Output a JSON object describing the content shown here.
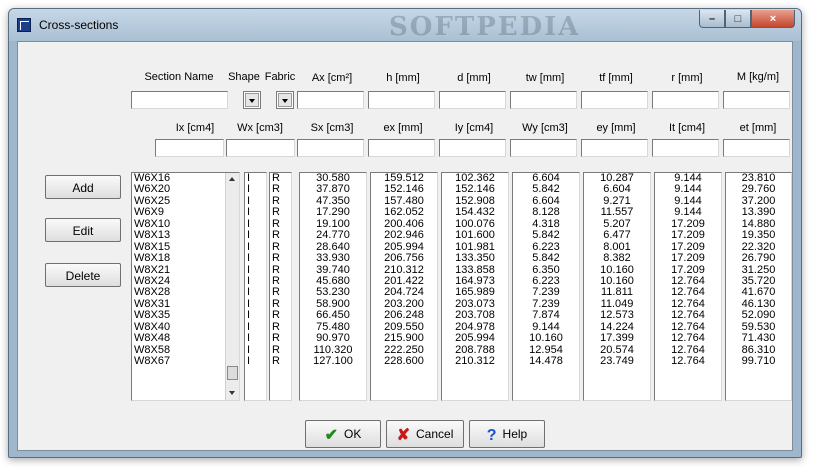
{
  "window": {
    "title": "Cross-sections",
    "watermark": "SOFTPEDIA",
    "controls": {
      "minimize": "–",
      "maximize": "□",
      "close": "×"
    }
  },
  "headers1": [
    "Section Name",
    "Shape",
    "Fabric",
    "Ax  [cm²]",
    "h  [mm]",
    "d  [mm]",
    "tw  [mm]",
    "tf  [mm]",
    "r  [mm]",
    "M  [kg/m]"
  ],
  "headers2": [
    "Ix  [cm4]",
    "Wx  [cm3]",
    "Sx  [cm3]",
    "ex  [mm]",
    "Iy  [cm4]",
    "Wy  [cm3]",
    "ey [mm]",
    "It  [cm4]",
    "et  [mm]"
  ],
  "filters": {
    "section_name": "",
    "shape": "",
    "fabric": "",
    "ax": "",
    "h": "",
    "d": "",
    "tw": "",
    "tf": "",
    "r": "",
    "m": ""
  },
  "filters2": {
    "ix": "",
    "wx": "",
    "sx": "",
    "ex": "",
    "iy": "",
    "wy": "",
    "ey": "",
    "it": "",
    "et": ""
  },
  "buttons": {
    "add": "Add",
    "edit": "Edit",
    "delete": "Delete",
    "ok": "OK",
    "cancel": "Cancel",
    "help": "Help"
  },
  "icons": {
    "ok": "checkmark-icon",
    "cancel": "x-icon",
    "help": "question-icon",
    "app": "app-icon"
  },
  "colors": {
    "ok_icon": "#1e8a1e",
    "cancel_icon": "#c81818",
    "help_icon": "#1f4fc8"
  },
  "table": {
    "names": [
      "W6X16",
      "W6X20",
      "W6X25",
      "W6X9",
      "W8X10",
      "W8X13",
      "W8X15",
      "W8X18",
      "W8X21",
      "W8X24",
      "W8X28",
      "W8X31",
      "W8X35",
      "W8X40",
      "W8X48",
      "W8X58",
      "W8X67"
    ],
    "shape": [
      "I",
      "I",
      "I",
      "I",
      "I",
      "I",
      "I",
      "I",
      "I",
      "I",
      "I",
      "I",
      "I",
      "I",
      "I",
      "I",
      "I"
    ],
    "fabric": [
      "R",
      "R",
      "R",
      "R",
      "R",
      "R",
      "R",
      "R",
      "R",
      "R",
      "R",
      "R",
      "R",
      "R",
      "R",
      "R",
      "R"
    ],
    "ax": [
      "30.580",
      "37.870",
      "47.350",
      "17.290",
      "19.100",
      "24.770",
      "28.640",
      "33.930",
      "39.740",
      "45.680",
      "53.230",
      "58.900",
      "66.450",
      "75.480",
      "90.970",
      "110.320",
      "127.100"
    ],
    "h": [
      "159.512",
      "152.146",
      "157.480",
      "162.052",
      "200.406",
      "202.946",
      "205.994",
      "206.756",
      "210.312",
      "201.422",
      "204.724",
      "203.200",
      "206.248",
      "209.550",
      "215.900",
      "222.250",
      "228.600"
    ],
    "d": [
      "102.362",
      "152.146",
      "152.908",
      "154.432",
      "100.076",
      "101.600",
      "101.981",
      "133.350",
      "133.858",
      "164.973",
      "165.989",
      "203.073",
      "203.708",
      "204.978",
      "205.994",
      "208.788",
      "210.312"
    ],
    "tw": [
      "6.604",
      "5.842",
      "6.604",
      "8.128",
      "4.318",
      "5.842",
      "6.223",
      "5.842",
      "6.350",
      "6.223",
      "7.239",
      "7.239",
      "7.874",
      "9.144",
      "10.160",
      "12.954",
      "14.478"
    ],
    "tf": [
      "10.287",
      "6.604",
      "9.271",
      "11.557",
      "5.207",
      "6.477",
      "8.001",
      "8.382",
      "10.160",
      "10.160",
      "11.811",
      "11.049",
      "12.573",
      "14.224",
      "17.399",
      "20.574",
      "23.749"
    ],
    "r": [
      "9.144",
      "9.144",
      "9.144",
      "9.144",
      "17.209",
      "17.209",
      "17.209",
      "17.209",
      "17.209",
      "12.764",
      "12.764",
      "12.764",
      "12.764",
      "12.764",
      "12.764",
      "12.764",
      "12.764"
    ],
    "m": [
      "23.810",
      "29.760",
      "37.200",
      "13.390",
      "14.880",
      "19.350",
      "22.320",
      "26.790",
      "31.250",
      "35.720",
      "41.670",
      "46.130",
      "52.090",
      "59.530",
      "71.430",
      "86.310",
      "99.710"
    ]
  }
}
